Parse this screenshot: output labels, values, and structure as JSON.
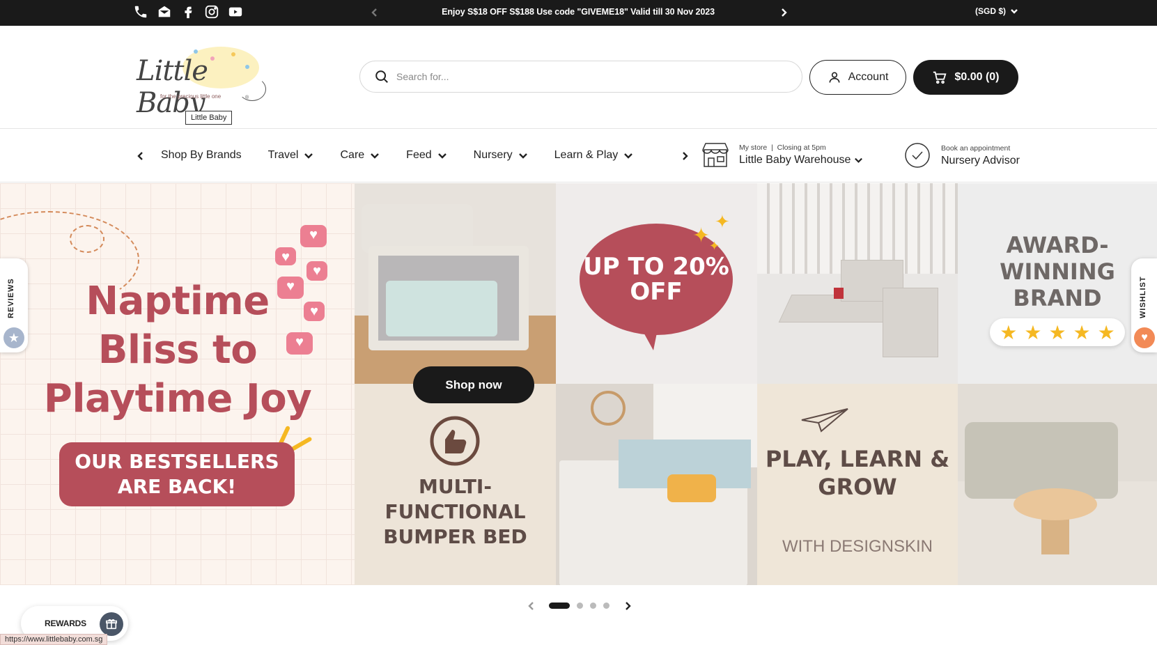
{
  "announcement": {
    "text": "Enjoy S$18 OFF S$188 Use code \"GIVEME18\" Valid till 30 Nov 2023",
    "currency": "(SGD $)"
  },
  "social_icons": [
    "phone-icon",
    "email-icon",
    "facebook-icon",
    "instagram-icon",
    "youtube-icon"
  ],
  "logo": {
    "wordmark": "Little Baby",
    "tagline": "for the precious little one",
    "tooltip": "Little Baby"
  },
  "search": {
    "placeholder": "Search for..."
  },
  "account": {
    "label": "Account"
  },
  "cart": {
    "label": "$0.00 (0)"
  },
  "nav": {
    "items": [
      {
        "label": "Shop By Brands",
        "has_dropdown": false
      },
      {
        "label": "Travel",
        "has_dropdown": true
      },
      {
        "label": "Care",
        "has_dropdown": true
      },
      {
        "label": "Feed",
        "has_dropdown": true
      },
      {
        "label": "Nursery",
        "has_dropdown": true
      },
      {
        "label": "Learn & Play",
        "has_dropdown": true
      }
    ]
  },
  "store": {
    "prefix": "My store",
    "hours": "Closing at 5pm",
    "name": "Little Baby Warehouse"
  },
  "appointment": {
    "prefix": "Book an appointment",
    "name": "Nursery Advisor"
  },
  "hero": {
    "headline": "Naptime Bliss to Playtime Joy",
    "badge": "OUR BESTSELLERS ARE BACK!",
    "sale": "UP TO 20% OFF",
    "award": "AWARD-WINNING BRAND",
    "bumper": "MULTI-FUNCTIONAL BUMPER BED",
    "play": "PLAY, LEARN & GROW",
    "play_sub": "WITH DESIGNSKIN",
    "cta": "Shop now",
    "stars": 5
  },
  "slider": {
    "slides": 4,
    "active": 1
  },
  "side_tabs": {
    "reviews": "REVIEWS",
    "wishlist": "WISHLIST"
  },
  "rewards": {
    "label": "REWARDS"
  },
  "status_url": "https://www.littlebaby.com.sg",
  "colors": {
    "brand_red": "#b64e5a",
    "dark": "#1a1a1a",
    "star": "#f5b822"
  }
}
